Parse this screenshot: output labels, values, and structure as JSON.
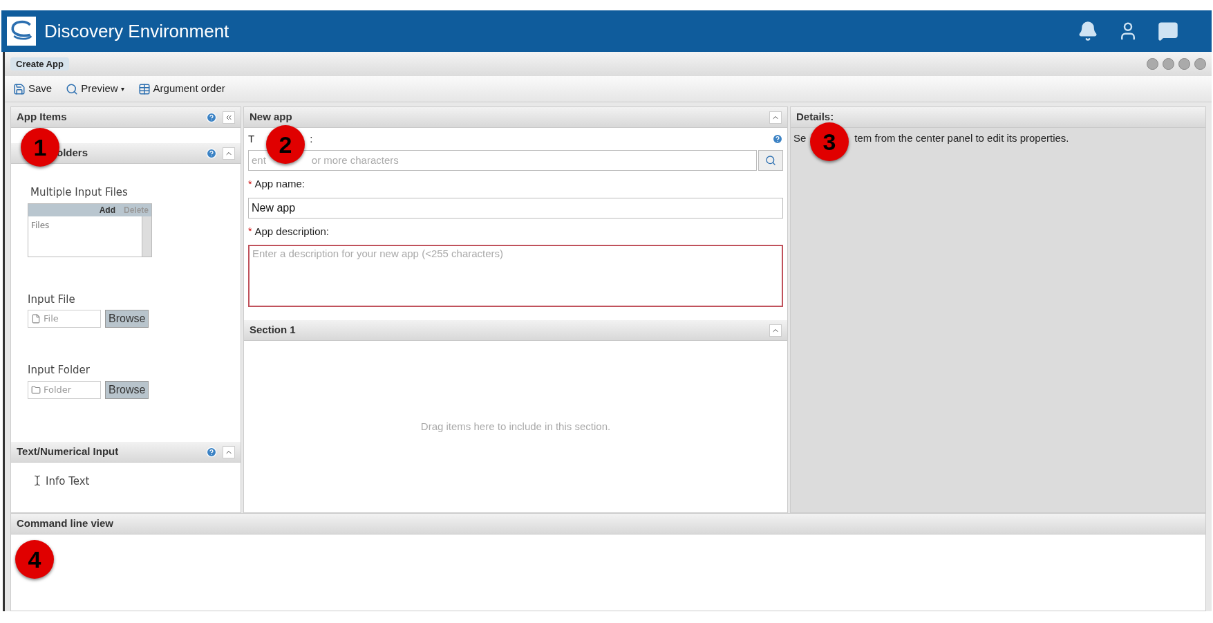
{
  "app": {
    "title": "Discovery Environment"
  },
  "window": {
    "title": "Create App"
  },
  "toolbar": [
    {
      "kind": "save",
      "label": "Save"
    },
    {
      "kind": "preview",
      "label": "Preview",
      "dropdown_caret": "▾"
    },
    {
      "kind": "order",
      "label": "Argument order"
    }
  ],
  "left_panel": {
    "title": "App Items",
    "group_title": "olders",
    "multi": {
      "label": "Multiple Input Files",
      "add": "Add",
      "delete": "Delete",
      "item": "Files"
    },
    "input_file": {
      "label": "Input File",
      "placeholder": "File",
      "button": "Browse"
    },
    "input_folder": {
      "label": "Input Folder",
      "placeholder": "Folder",
      "button": "Browse"
    },
    "text_group": {
      "title": "Text/Numerical Input",
      "item": "Info Text"
    }
  },
  "center_panel": {
    "title": "New app",
    "tool_label_start": "T",
    "tool_label_end": ":",
    "tool_placeholder_start": "ent",
    "tool_placeholder_end": "or more characters",
    "required_mark": "*",
    "name_label": "App name:",
    "name_value": "New app",
    "desc_label": "App description:",
    "desc_placeholder": "Enter a description for your new app (<255 characters)",
    "section_title": "Section 1",
    "section_hint": "Drag items here to include in this section."
  },
  "details_panel": {
    "title": "Details:",
    "text_start": "Se",
    "text_end": "tem from the center panel to edit its properties."
  },
  "command_line": {
    "title": "Command line view"
  },
  "callouts": [
    "1",
    "2",
    "3",
    "4"
  ]
}
